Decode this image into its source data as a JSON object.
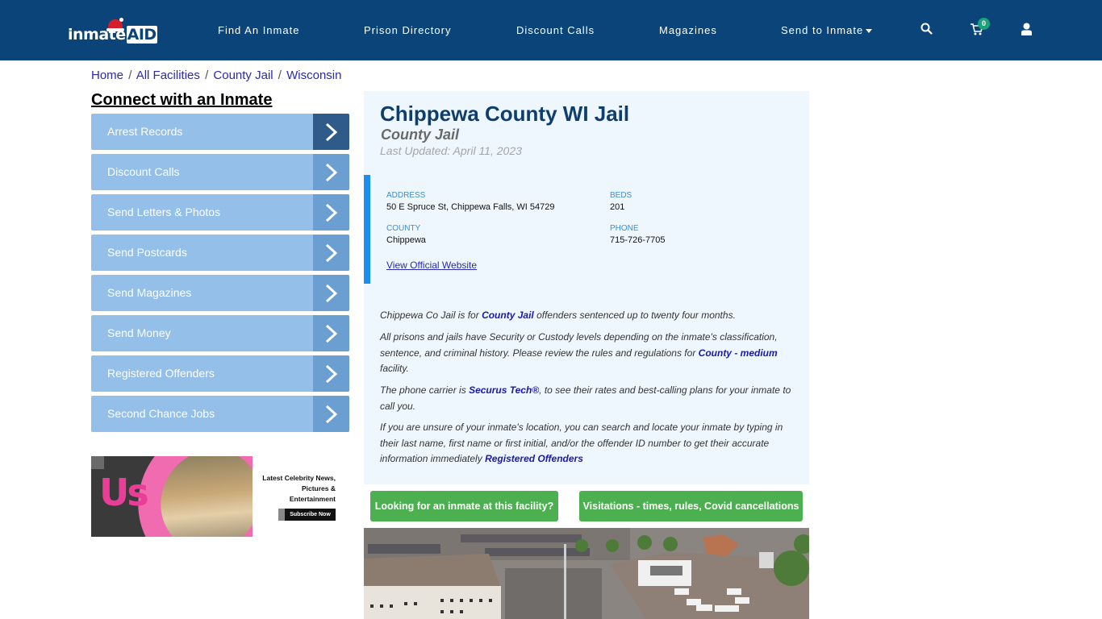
{
  "header": {
    "logo_text": "inmate",
    "logo_text_accent": "AID",
    "nav": [
      {
        "label": "Find An Inmate"
      },
      {
        "label": "Prison Directory"
      },
      {
        "label": "Discount Calls"
      },
      {
        "label": "Magazines"
      },
      {
        "label": "Send to Inmate",
        "has_dropdown": true
      }
    ],
    "cart_count": "0",
    "icons": [
      "search-icon",
      "cart-icon",
      "user-icon"
    ]
  },
  "breadcrumb": [
    {
      "label": "Home"
    },
    {
      "label": "All Facilities"
    },
    {
      "label": "County Jail"
    },
    {
      "label": "Wisconsin"
    }
  ],
  "breadcrumb_separator": "/",
  "sidebar": {
    "title": "Connect with an Inmate",
    "items": [
      {
        "label": "Arrest Records"
      },
      {
        "label": "Discount Calls"
      },
      {
        "label": "Send Letters & Photos"
      },
      {
        "label": "Send Postcards"
      },
      {
        "label": "Send Magazines"
      },
      {
        "label": "Send Money"
      },
      {
        "label": "Registered Offenders"
      },
      {
        "label": "Second Chance Jobs"
      }
    ],
    "ad": {
      "brand": "Us",
      "headline": "Latest Celebrity News, Pictures & Entertainment",
      "cta": "Subscribe Now"
    }
  },
  "facility": {
    "name": "Chippewa County WI Jail",
    "type": "County Jail",
    "last_updated": "Last Updated: April 11, 2023",
    "address_label": "ADDRESS",
    "address": "50 E Spruce St, Chippewa Falls, WI 54729",
    "beds_label": "BEDS",
    "beds": "201",
    "county_label": "COUNTY",
    "county": "Chippewa",
    "phone_label": "PHONE",
    "phone": "715-726-7705",
    "website_link": "View Official Website"
  },
  "description": {
    "p1_a": "Chippewa Co Jail is for ",
    "p1_link": "County Jail",
    "p1_b": " offenders sentenced up to twenty four months.",
    "p2_a": "All prisons and jails have Security or Custody levels depending on the inmate's classification, sentence, and criminal history. Please review the rules and regulations for ",
    "p2_link": "County - medium",
    "p2_b": " facility.",
    "p3_a": "The phone carrier is ",
    "p3_link": "Securus Tech®",
    "p3_b": ", to see their rates and best-calling plans for your inmate to call you.",
    "p4_a": "If you are unsure of your inmate's location, you can search and locate your inmate by typing in their last name, first name or first initial, and/or the offender ID number to get their accurate information immediately ",
    "p4_link": "Registered Offenders"
  },
  "buttons": {
    "find_inmate": "Looking for an inmate at this facility?",
    "visitations": "Visitations - times, rules, Covid cancellations"
  },
  "colors": {
    "header_bg": "#0b4479",
    "sidebar_item": "#93bfe8",
    "sidebar_arrow": "#6b9fd1",
    "sidebar_arrow_active": "#2f5b8a",
    "green_button": "#4caf50",
    "card_bg": "#eef7fe",
    "accent_bar": "#1a8ff0"
  }
}
